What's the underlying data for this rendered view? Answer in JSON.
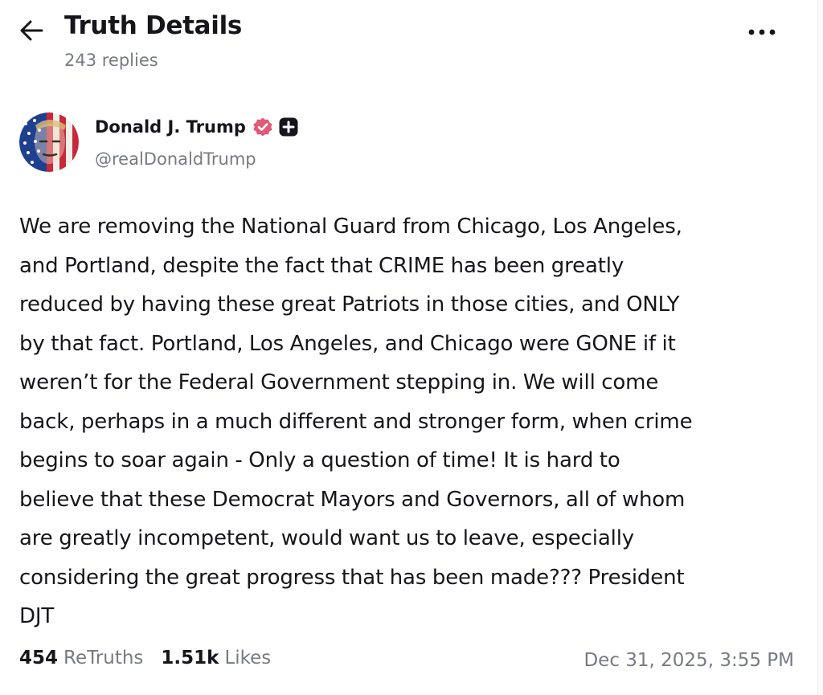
{
  "header": {
    "title": "Truth Details",
    "reply_count": "243 replies"
  },
  "icons": {
    "back": "arrow-left-icon",
    "more": "more-horizontal-icon",
    "verified": "verified-badge-icon",
    "plus": "plus-badge-icon"
  },
  "colors": {
    "verified_badge": "#e25a78",
    "text_primary": "#15151b",
    "text_secondary": "#777a85"
  },
  "post": {
    "author": {
      "name": "Donald J. Trump",
      "handle": "@realDonaldTrump"
    },
    "lines": [
      "We are removing the National Guard from Chicago, Los Angeles,",
      "and Portland, despite the fact that CRIME has been greatly",
      "reduced by having these great Patriots in those cities, and ONLY",
      "by that fact. Portland, Los Angeles, and Chicago were GONE if it",
      "weren’t for the Federal Government stepping in. We will come",
      "back, perhaps in a much different and stronger form, when crime",
      "begins to soar again - Only a question of time! It is hard to",
      "believe that these Democrat Mayors and Governors, all of whom",
      "are greatly incompetent, would want us to leave, especially",
      "considering the great progress that has been made??? President",
      "DJT"
    ],
    "stats": {
      "retruths_count": "454",
      "retruths_label": "ReTruths",
      "likes_count": "1.51k",
      "likes_label": "Likes"
    },
    "timestamp": "Dec 31, 2025, 3:55 PM"
  }
}
